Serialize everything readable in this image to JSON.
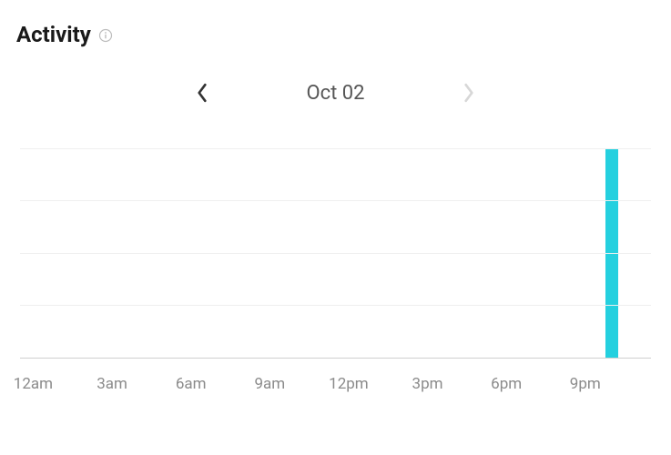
{
  "header": {
    "title": "Activity"
  },
  "date_nav": {
    "date_label": "Oct 02",
    "prev_enabled": true,
    "next_enabled": false
  },
  "chart_data": {
    "type": "bar",
    "title": "Activity",
    "xlabel": "",
    "ylabel": "",
    "ylim": [
      0,
      100
    ],
    "x_ticks": [
      "12am",
      "3am",
      "6am",
      "9am",
      "12pm",
      "3pm",
      "6pm",
      "9pm"
    ],
    "categories": [
      "12am",
      "1am",
      "2am",
      "3am",
      "4am",
      "5am",
      "6am",
      "7am",
      "8am",
      "9am",
      "10am",
      "11am",
      "12pm",
      "1pm",
      "2pm",
      "3pm",
      "4pm",
      "5pm",
      "6pm",
      "7pm",
      "8pm",
      "9pm",
      "10pm",
      "11pm"
    ],
    "values": [
      0,
      0,
      0,
      0,
      0,
      0,
      0,
      0,
      0,
      0,
      0,
      0,
      0,
      0,
      0,
      0,
      0,
      0,
      0,
      0,
      0,
      0,
      100,
      0
    ],
    "gridlines": [
      0,
      25,
      50,
      75,
      100
    ],
    "colors": {
      "bar": "#24d0df"
    }
  }
}
